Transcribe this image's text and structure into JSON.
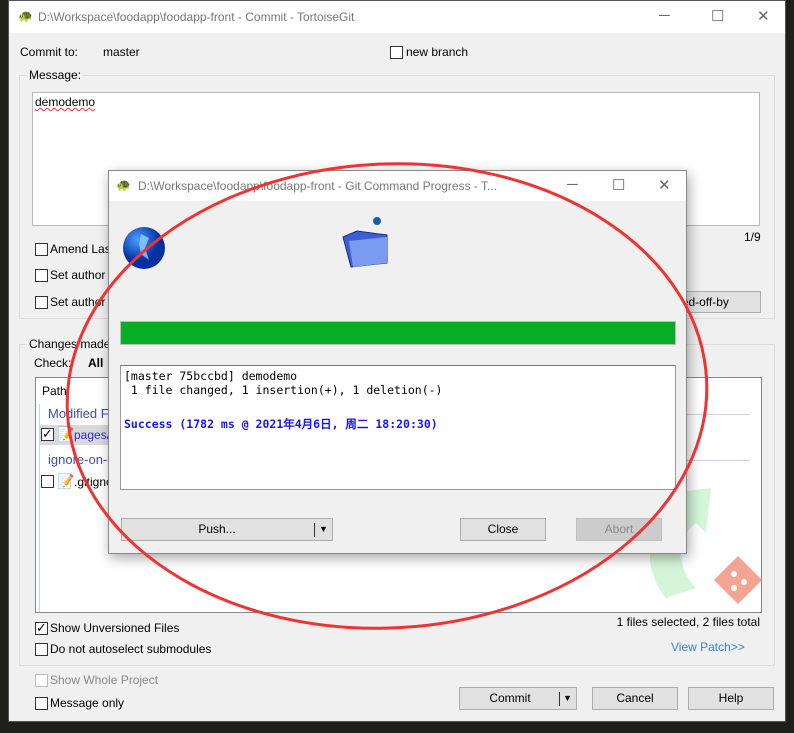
{
  "main_window": {
    "title": "D:\\Workspace\\foodapp\\foodapp-front - Commit - TortoiseGit",
    "commit_to_label": "Commit to:",
    "branch": "master",
    "new_branch_label": "new branch",
    "message_label": "Message:",
    "message_text": "demodemo",
    "message_counter": "1/9",
    "amend_label": "Amend Last Commit",
    "set_author_date_label": "Set author date",
    "set_author_label": "Set author",
    "signed_off_label": "Add Signed-off-by",
    "changes_label": "Changes made (double-click on file for diff):",
    "check_label": "Check:",
    "check_all": "All",
    "list": {
      "header_path": "Path",
      "groups": [
        {
          "name": "Modified Files",
          "files": [
            {
              "path": "pages/",
              "checked": true
            }
          ]
        },
        {
          "name": "ignore-on-commit",
          "files": [
            {
              "path": ".gitignore",
              "checked": false
            }
          ]
        }
      ]
    },
    "show_unversioned_label": "Show Unversioned Files",
    "show_unversioned_checked": true,
    "no_autoselect_label": "Do not autoselect submodules",
    "files_status": "1 files selected, 2 files total",
    "view_patch": "View Patch>>",
    "show_whole_project_label": "Show Whole Project",
    "message_only_label": "Message only",
    "commit_button": "Commit",
    "cancel_button": "Cancel",
    "help_button": "Help"
  },
  "progress_dialog": {
    "title": "D:\\Workspace\\foodapp\\foodapp-front - Git Command Progress - T...",
    "progress_percent": 100,
    "progress_color": "#06ad25",
    "log_lines": [
      "[master 75bccbd] demodemo",
      " 1 file changed, 1 insertion(+), 1 deletion(-)"
    ],
    "success_line": "Success (1782 ms @ 2021年4月6日, 周二 18:20:30)",
    "push_button": "Push...",
    "close_button": "Close",
    "abort_button": "Abort"
  },
  "annotation_color": "#ee3333"
}
